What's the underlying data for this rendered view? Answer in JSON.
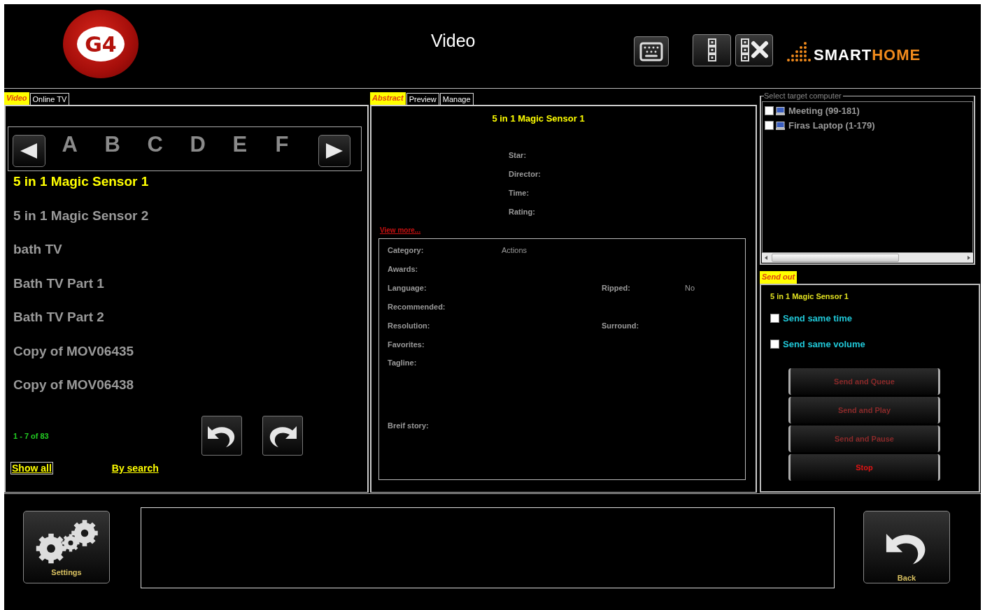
{
  "header": {
    "logo": "G4",
    "title": "Video",
    "brand": [
      "SMART",
      "HOME"
    ]
  },
  "library": {
    "tabs": [
      {
        "label": "Video",
        "selected": true
      },
      {
        "label": "Online TV",
        "selected": false
      }
    ],
    "letters": [
      "A",
      "B",
      "C",
      "D",
      "E",
      "F"
    ],
    "items": [
      {
        "label": "5 in 1 Magic Sensor 1",
        "selected": true
      },
      {
        "label": "5 in 1 Magic Sensor 2",
        "selected": false
      },
      {
        "label": "bath TV",
        "selected": false
      },
      {
        "label": "Bath TV Part 1",
        "selected": false
      },
      {
        "label": "Bath TV Part 2",
        "selected": false
      },
      {
        "label": "Copy of MOV06435",
        "selected": false
      },
      {
        "label": "Copy of MOV06438",
        "selected": false
      }
    ],
    "pager": "1 - 7 of 83",
    "links": [
      {
        "label": "Show all",
        "selected": true
      },
      {
        "label": "By search",
        "selected": false
      }
    ]
  },
  "details": {
    "tabs": [
      {
        "label": "Abstract",
        "selected": true
      },
      {
        "label": "Preview",
        "selected": false
      },
      {
        "label": "Manage",
        "selected": false
      }
    ],
    "title": "5 in 1 Magic Sensor 1",
    "info": [
      "Star:",
      "Director:",
      "Time:",
      "Rating:"
    ],
    "view_more": "View more...",
    "fields": [
      {
        "label": "Category:",
        "value": "Actions",
        "kind": "line"
      },
      {
        "label": "Awards:",
        "kind": "line"
      },
      {
        "label": "Language:",
        "label_2": "Ripped:",
        "value_2": "No",
        "kind": "line"
      },
      {
        "label": "Recommended:",
        "kind": "line"
      },
      {
        "label": "Resolution:",
        "label_2": "Surround:",
        "kind": "line"
      },
      {
        "label": "Favorites:",
        "kind": "line"
      },
      {
        "label": "Tagline:",
        "kind": "long"
      },
      {
        "label": "Breif story:",
        "kind": "line"
      }
    ]
  },
  "targets": {
    "legend": "Select target computer",
    "items": [
      {
        "label": "Meeting (99-181)",
        "checked": false
      },
      {
        "label": "Firas Laptop (1-179)",
        "checked": false
      }
    ]
  },
  "send_out": {
    "tab": {
      "label": "Send out",
      "selected": true
    },
    "title": "5 in 1 Magic Sensor 1",
    "options": [
      {
        "label": "Send same time",
        "checked": false
      },
      {
        "label": "Send same volume",
        "checked": false
      }
    ],
    "buttons": [
      {
        "label": "Send and Queue",
        "disabled": true
      },
      {
        "label": "Send and Play",
        "disabled": true
      },
      {
        "label": "Send and Pause",
        "disabled": true
      },
      {
        "label": "Stop",
        "disabled": false
      }
    ]
  },
  "footer": {
    "settings": "Settings",
    "back": "Back"
  }
}
